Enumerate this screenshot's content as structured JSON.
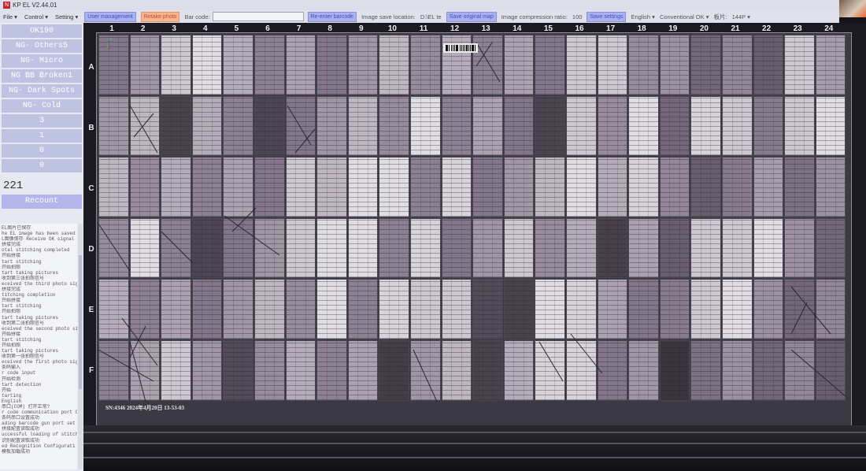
{
  "window": {
    "title": "KP EL V2.44.01",
    "logo": "N"
  },
  "menu": {
    "file": "File",
    "control": "Control",
    "setting": "Setting"
  },
  "toolbar": {
    "user_management": "User management",
    "retake_photo": "Retake photo",
    "bar_code_label": "Bar code:",
    "bar_code_value": "",
    "re_enter_barcode": "Re-enter barcode",
    "image_save_location_label": "Image save location:",
    "image_save_location_value": "D:\\EL te",
    "save_original_map": "Save original map",
    "compression_label": "Image compression ratio:",
    "compression_value": "100",
    "save_settings": "Save settings",
    "language": "English",
    "result_mode": "Conventional OK",
    "layout_label": "板片:",
    "layout_value": "144P"
  },
  "sidebar": {
    "categories": [
      "OK190",
      "NG- Others5",
      "NG- Micro",
      "NG BB Broken1",
      "NG- Dark Spots",
      "NG- Cold"
    ],
    "counts": [
      "3",
      "1",
      "0",
      "0"
    ],
    "total": "221",
    "recount": "Recount",
    "log_lines": [
      "EL图片已保存",
      "he EL image has been saved",
      "L图像保存 Receive OK signal",
      "拼接完成",
      "otal stitching completed",
      "开始拼接",
      "tart stitching",
      "开始拍照",
      "tart taking pictures",
      "收到第三张拍照信号",
      "eceived the third photo sig",
      "拼接完成",
      "titching completion",
      "开始拼接",
      "tart stitching",
      "开始拍照",
      "tart taking pictures",
      "收到第二张拍照信号",
      "eceived the second photo si",
      "开始拼接",
      "tart stitching",
      "开始拍照",
      "tart taking pictures",
      "收到第一张拍照信号",
      "eceived the first photo sig",
      "条码输入",
      "r code input",
      "开始检测",
      "tart detection",
      "开始",
      "tarting",
      "English",
      "串口(COM) 打开正常?",
      "r code communication port C",
      "条码串口设置成功",
      "ading barcode gun port set",
      "拼接配置读取成功",
      "uccessful loading of stitchi",
      "识别配置读取成功",
      "ed Recognition Configurati",
      "模板加载成功"
    ]
  },
  "image": {
    "columns": [
      "1",
      "2",
      "3",
      "4",
      "5",
      "6",
      "7",
      "8",
      "9",
      "10",
      "11",
      "12",
      "13",
      "14",
      "15",
      "16",
      "17",
      "18",
      "19",
      "20",
      "21",
      "22",
      "23",
      "24"
    ],
    "rows": [
      "A",
      "B",
      "C",
      "D",
      "E",
      "F"
    ],
    "sn_text": "SN:4346   2024年4月20日   13-53-03"
  },
  "colors": {
    "accent": "#a9b1ee",
    "accent_text": "#3f4fc4",
    "retake": "#f7b58f",
    "stat_bg": "#bec3e2",
    "recount_bg": "#b5b6ea"
  }
}
